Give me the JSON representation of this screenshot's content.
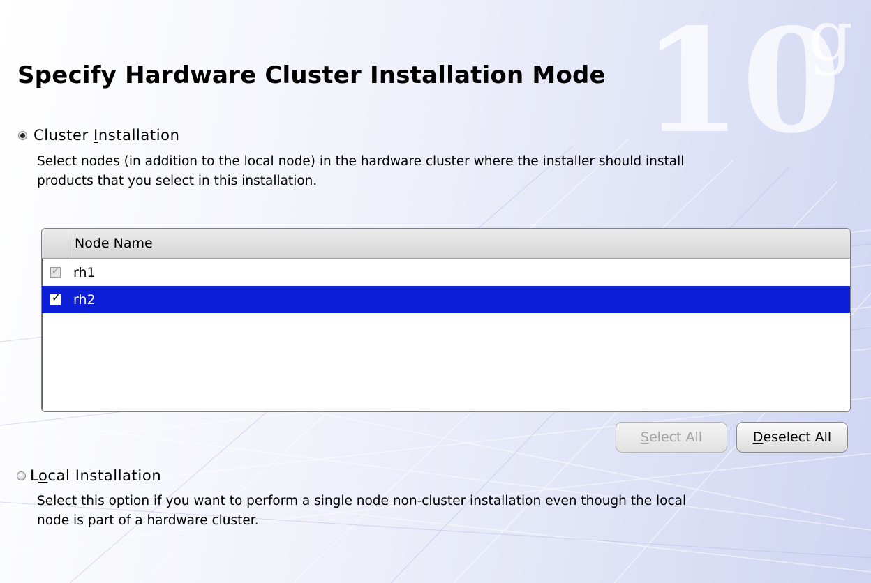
{
  "page": {
    "title": "Specify Hardware Cluster Installation Mode",
    "watermark": {
      "number": "10",
      "letter": "g"
    }
  },
  "cluster_option": {
    "label_pre": "Cluster ",
    "label_mnemonic": "I",
    "label_post": "nstallation",
    "selected": true,
    "description_line1": "Select nodes (in addition to the local node) in the hardware cluster where the installer should install",
    "description_line2": "products that you select in this installation."
  },
  "node_table": {
    "header": "Node Name",
    "rows": [
      {
        "name": "rh1",
        "checked": true,
        "disabled": true,
        "selected": false
      },
      {
        "name": "rh2",
        "checked": true,
        "disabled": false,
        "selected": true
      }
    ]
  },
  "buttons": {
    "select_all": {
      "mnemonic": "S",
      "rest": "elect All",
      "enabled": false
    },
    "deselect_all": {
      "mnemonic": "D",
      "rest": "eselect All",
      "enabled": true
    }
  },
  "local_option": {
    "label_pre": "L",
    "label_mnemonic": "o",
    "label_post": "cal Installation",
    "selected": false,
    "description_line1": "Select this option if you want to perform a single node non-cluster installation even though the local",
    "description_line2": "node is part of a hardware cluster."
  },
  "colors": {
    "selection": "#0c1fd6",
    "background_accent": "#cfd5f2",
    "watermark": "#ffffff"
  }
}
